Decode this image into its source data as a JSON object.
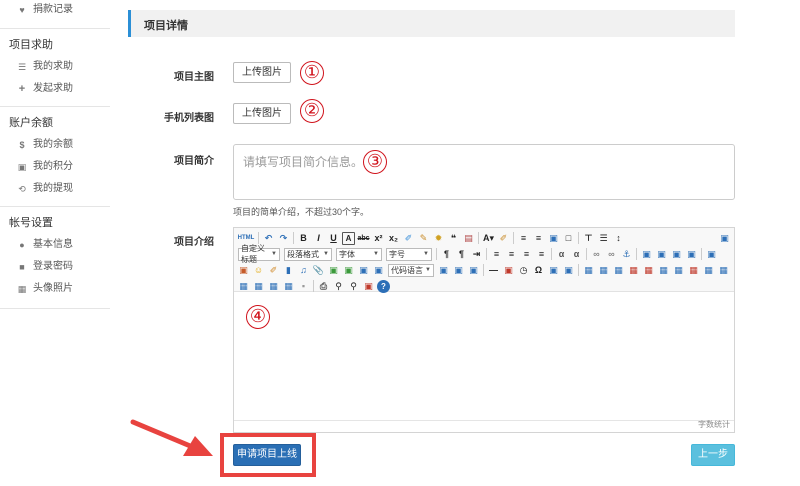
{
  "sidebar": {
    "top_item": {
      "icon": "heart-icon",
      "label": "捐款记录"
    },
    "groups": [
      {
        "title": "项目求助",
        "items": [
          {
            "icon": "list-icon",
            "label": "我的求助"
          },
          {
            "icon": "plus-icon",
            "label": "发起求助"
          }
        ]
      },
      {
        "title": "账户余额",
        "items": [
          {
            "icon": "dollar-icon",
            "label": "我的余额"
          },
          {
            "icon": "gift-icon",
            "label": "我的积分"
          },
          {
            "icon": "upload-circle-icon",
            "label": "我的提现"
          }
        ]
      },
      {
        "title": "帐号设置",
        "items": [
          {
            "icon": "user-icon",
            "label": "基本信息"
          },
          {
            "icon": "lock-icon",
            "label": "登录密码"
          },
          {
            "icon": "picture-icon",
            "label": "头像照片"
          }
        ]
      }
    ]
  },
  "section": {
    "title": "项目详情"
  },
  "form": {
    "main_image": {
      "label": "项目主图",
      "button": "上传图片",
      "marker": "①"
    },
    "mobile_image": {
      "label": "手机列表图",
      "button": "上传图片",
      "marker": "②"
    },
    "summary": {
      "label": "项目简介",
      "placeholder": "请填写项目简介信息。",
      "marker": "③",
      "help": "项目的简单介绍，不超过30个字。"
    },
    "intro": {
      "label": "项目介绍",
      "marker": "④",
      "wordcount": "字数统计"
    }
  },
  "editor": {
    "selects": [
      {
        "label": "自定义标题"
      },
      {
        "label": "段落格式"
      },
      {
        "label": "字体"
      },
      {
        "label": "字号"
      },
      {
        "label": "代码语言"
      }
    ],
    "colors": {
      "accent": "#2b8fd6",
      "red": "#d0121b",
      "blue_icon": "#2d6fb7"
    }
  },
  "actions": {
    "submit": "申请项目上线",
    "prev": "上一步"
  },
  "colors": {
    "primary": "#2a6fb5",
    "info": "#5bc0de",
    "highlight": "#e8433f"
  }
}
